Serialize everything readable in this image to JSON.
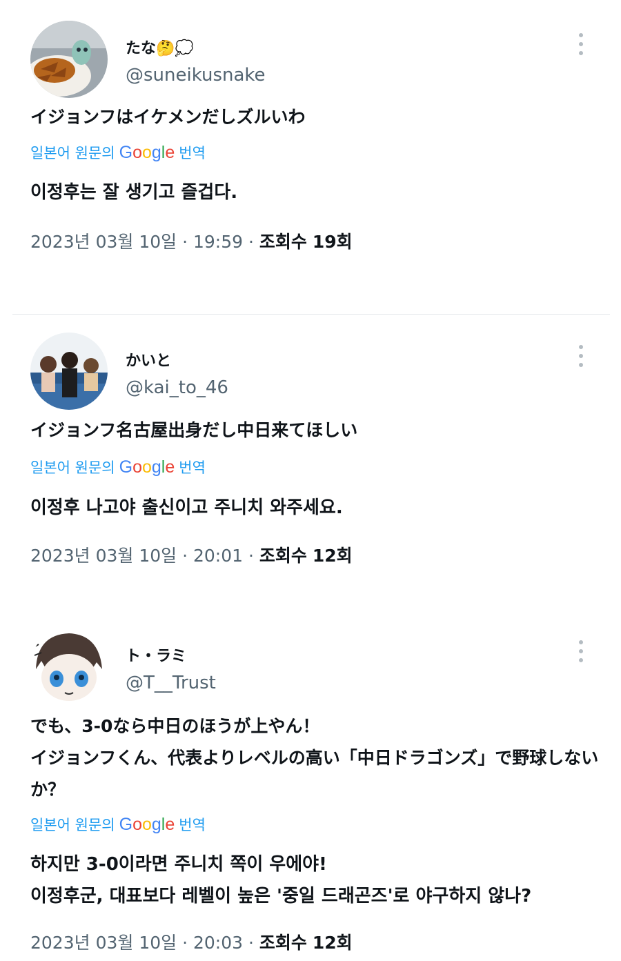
{
  "tweets": [
    {
      "name": "たな🤔💭",
      "handle": "@suneikusnake",
      "text": [
        "イジョンフはイケメンだしズルいわ"
      ],
      "translate_prefix": "일본어 원문의",
      "translate_brand": "Google",
      "translate_suffix": "번역",
      "translation": [
        "이정후는 잘 생기고 즐겁다."
      ],
      "date": "2023년 03월 10일",
      "time": "19:59",
      "views_label": "조회수",
      "views": "19회"
    },
    {
      "name": "かいと",
      "handle": "@kai_to_46",
      "text": [
        "イジョンフ名古屋出身だし中日来てほしい"
      ],
      "translate_prefix": "일본어 원문의",
      "translate_brand": "Google",
      "translate_suffix": "번역",
      "translation": [
        "이정후 나고야 출신이고 주니치 와주세요."
      ],
      "date": "2023년 03월 10일",
      "time": "20:01",
      "views_label": "조회수",
      "views": "12회"
    },
    {
      "name": "ト・ラミ",
      "handle": "@T__Trust",
      "text": [
        "でも、3-0なら中日のほうが上やん！",
        "イジョンフくん、代表よりレベルの高い「中日ドラゴンズ」で野球しない",
        "か？"
      ],
      "translate_prefix": "일본어 원문의",
      "translate_brand": "Google",
      "translate_suffix": "번역",
      "translation": [
        "하지만 3-0이라면 주니치 쪽이 우에야!",
        "이정후군, 대표보다 레벨이 높은 '중일 드래곤즈'로 야구하지 않나?"
      ],
      "date": "2023년 03월 10일",
      "time": "20:03",
      "views_label": "조회수",
      "views": "12회"
    }
  ],
  "colors": {
    "link": "#1d9bf0",
    "secondary_text": "#536471",
    "primary_text": "#0f1419"
  }
}
